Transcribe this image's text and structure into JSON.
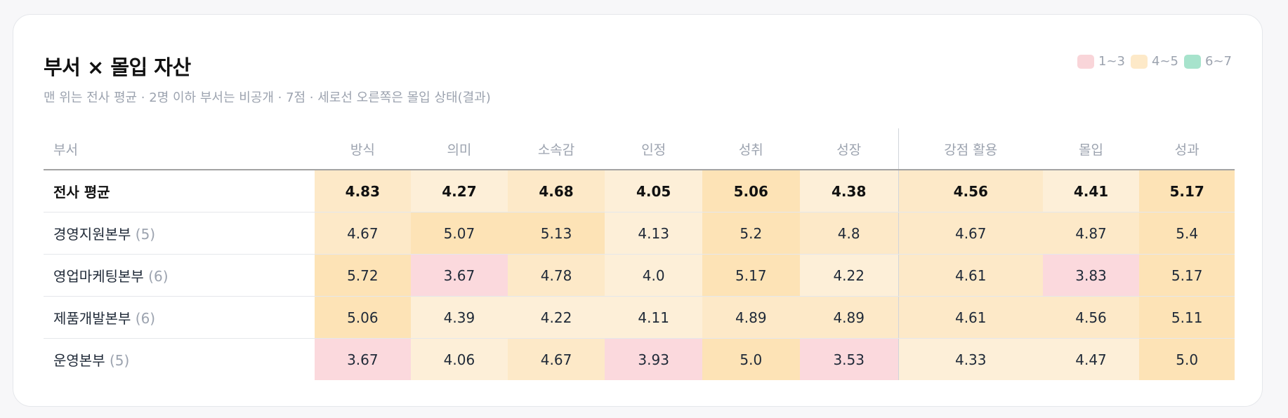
{
  "title": "부서 × 몰입 자산",
  "subtitle": "맨 위는 전사 평균 · 2명 이하 부서는 비공개 · 7점  · 세로선 오른쪽은 몰입 상태(결과)",
  "legend": [
    {
      "label": "1~3",
      "color": "#f9d5d9"
    },
    {
      "label": "4~5",
      "color": "#fde9c8"
    },
    {
      "label": "6~7",
      "color": "#a7e3cc"
    }
  ],
  "table": {
    "dept_header": "부서",
    "columns": [
      "방식",
      "의미",
      "소속감",
      "인정",
      "성취",
      "성장",
      "강점 활용",
      "몰입",
      "성과"
    ],
    "rows": [
      {
        "name": "전사 평균",
        "count": "",
        "values": [
          "4.83",
          "4.27",
          "4.68",
          "4.05",
          "5.06",
          "4.38",
          "4.56",
          "4.41",
          "5.17"
        ]
      },
      {
        "name": "경영지원본부",
        "count": "(5)",
        "values": [
          "4.67",
          "5.07",
          "5.13",
          "4.13",
          "5.2",
          "4.8",
          "4.67",
          "4.87",
          "5.4"
        ]
      },
      {
        "name": "영업마케팅본부",
        "count": "(6)",
        "values": [
          "5.72",
          "3.67",
          "4.78",
          "4.0",
          "5.17",
          "4.22",
          "4.61",
          "3.83",
          "5.17"
        ]
      },
      {
        "name": "제품개발본부",
        "count": "(6)",
        "values": [
          "5.06",
          "4.39",
          "4.22",
          "4.11",
          "4.89",
          "4.89",
          "4.61",
          "4.56",
          "5.11"
        ]
      },
      {
        "name": "운영본부",
        "count": "(5)",
        "values": [
          "3.67",
          "4.06",
          "4.67",
          "3.93",
          "5.0",
          "3.53",
          "4.33",
          "4.47",
          "5.0"
        ]
      }
    ]
  },
  "colors": {
    "low": "#fbd9dd",
    "mid_light": "#fdefd8",
    "mid": "#fde9c8",
    "mid_strong": "#fde3b6",
    "high": "#a7e3cc"
  }
}
